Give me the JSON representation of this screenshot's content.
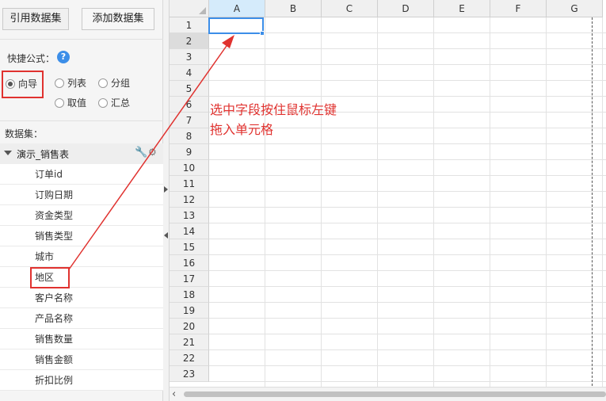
{
  "toolbar": {
    "ref_dataset_label": "引用数据集",
    "add_dataset_label": "添加数据集"
  },
  "quick_formula": {
    "label": "快捷公式：",
    "help_icon": "?",
    "options": {
      "wizard": "向导",
      "list": "列表",
      "group": "分组",
      "value": "取值",
      "summary": "汇总"
    },
    "selected": "向导"
  },
  "dataset": {
    "label": "数据集：",
    "name": "演示_销售表",
    "icons": [
      "wrench-icon",
      "gear-icon"
    ],
    "fields": [
      "订单id",
      "订购日期",
      "资金类型",
      "销售类型",
      "城市",
      "地区",
      "客户名称",
      "产品名称",
      "销售数量",
      "销售金额",
      "折扣比例"
    ]
  },
  "sheet": {
    "columns": [
      "A",
      "B",
      "C",
      "D",
      "E",
      "F",
      "G"
    ],
    "rows": [
      "1",
      "2",
      "3",
      "4",
      "5",
      "6",
      "7",
      "8",
      "9",
      "10",
      "11",
      "12",
      "13",
      "14",
      "15",
      "16",
      "17",
      "18",
      "19",
      "20",
      "21",
      "22",
      "23"
    ],
    "selected_cell": "A1"
  },
  "annotation": {
    "line1": "选中字段按住鼠标左键",
    "line2": "拖入单元格"
  },
  "colors": {
    "highlight": "#e0322f",
    "accent": "#3c8ee8"
  }
}
